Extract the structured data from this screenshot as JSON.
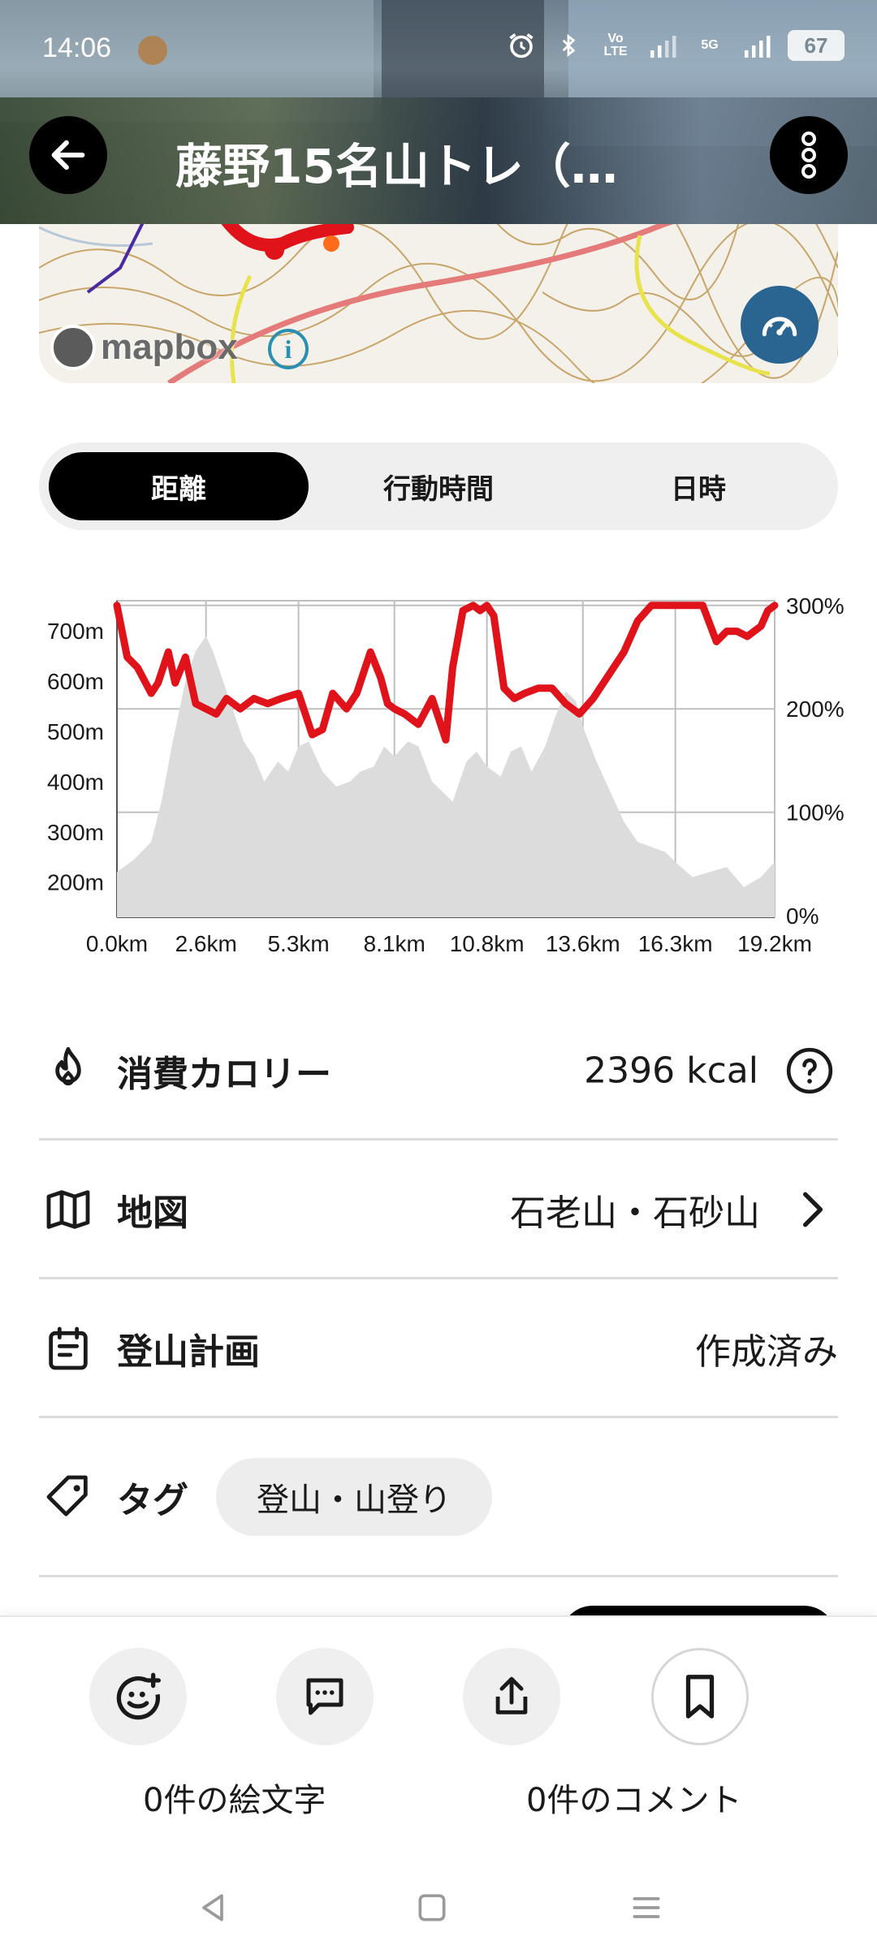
{
  "status_bar": {
    "time": "14:06",
    "network_label": "Vo LTE",
    "network_5g": "5G",
    "battery": "67"
  },
  "header": {
    "title": "藤野15名山トレ（…"
  },
  "map": {
    "attribution": "mapbox",
    "info_symbol": "i"
  },
  "segments": [
    {
      "label": "距離",
      "active": true
    },
    {
      "label": "行動時間",
      "active": false
    },
    {
      "label": "日時",
      "active": false
    }
  ],
  "chart_data": {
    "type": "area",
    "x_unit": "km",
    "x_tick_labels": [
      "0.0km",
      "2.6km",
      "5.3km",
      "8.1km",
      "10.8km",
      "13.6km",
      "16.3km",
      "19.2km"
    ],
    "x_range": [
      0.0,
      19.2
    ],
    "y_left_tick_labels": [
      "700m",
      "600m",
      "500m",
      "400m",
      "300m",
      "200m"
    ],
    "y_left_range": [
      130,
      760
    ],
    "y_right_tick_labels": [
      "300%",
      "200%",
      "100%",
      "0%"
    ],
    "y_right_range": [
      0,
      300
    ],
    "grid": true,
    "series": [
      {
        "kind": "elevation",
        "color": "#d9d9d9",
        "x": [
          0.0,
          0.5,
          1.0,
          1.3,
          1.6,
          2.0,
          2.3,
          2.6,
          2.8,
          3.1,
          3.4,
          3.7,
          4.0,
          4.3,
          4.7,
          5.0,
          5.3,
          5.6,
          6.0,
          6.4,
          6.8,
          7.1,
          7.5,
          7.8,
          8.1,
          8.5,
          8.8,
          9.2,
          9.5,
          9.8,
          10.2,
          10.5,
          10.8,
          11.2,
          11.5,
          11.8,
          12.1,
          12.5,
          12.8,
          13.1,
          13.4,
          13.6,
          14.0,
          14.4,
          14.8,
          15.2,
          15.6,
          16.0,
          16.3,
          16.8,
          17.3,
          17.8,
          18.3,
          18.8,
          19.2
        ],
        "y": [
          220,
          245,
          280,
          360,
          470,
          600,
          660,
          690,
          660,
          600,
          540,
          480,
          450,
          400,
          440,
          420,
          470,
          480,
          420,
          390,
          400,
          420,
          430,
          470,
          450,
          480,
          470,
          400,
          380,
          360,
          440,
          460,
          430,
          410,
          460,
          470,
          420,
          470,
          530,
          580,
          560,
          510,
          440,
          380,
          320,
          280,
          270,
          260,
          240,
          210,
          220,
          230,
          190,
          210,
          240
        ]
      },
      {
        "kind": "speed_percent",
        "color": "#e0121a",
        "x": [
          0.0,
          0.3,
          0.6,
          1.0,
          1.2,
          1.5,
          1.7,
          2.0,
          2.3,
          2.6,
          2.9,
          3.2,
          3.6,
          4.0,
          4.4,
          4.8,
          5.3,
          5.7,
          6.0,
          6.3,
          6.7,
          7.0,
          7.4,
          7.7,
          7.9,
          8.1,
          8.4,
          8.8,
          9.2,
          9.6,
          9.8,
          10.1,
          10.4,
          10.6,
          10.8,
          11.0,
          11.3,
          11.6,
          11.9,
          12.3,
          12.7,
          13.1,
          13.5,
          13.9,
          14.3,
          14.8,
          15.2,
          15.6,
          15.9,
          16.2,
          16.6,
          17.1,
          17.5,
          17.8,
          18.1,
          18.4,
          18.8,
          19.0,
          19.2
        ],
        "y": [
          300,
          250,
          240,
          215,
          225,
          255,
          225,
          250,
          205,
          200,
          195,
          210,
          200,
          210,
          205,
          210,
          215,
          175,
          180,
          215,
          200,
          215,
          255,
          230,
          205,
          200,
          195,
          185,
          210,
          170,
          240,
          295,
          300,
          295,
          300,
          290,
          220,
          210,
          215,
          220,
          220,
          205,
          195,
          210,
          230,
          255,
          285,
          300,
          300,
          300,
          300,
          300,
          265,
          275,
          275,
          270,
          280,
          295,
          300
        ]
      }
    ]
  },
  "rows": {
    "calories": {
      "label": "消費カロリー",
      "value": "2396 kcal"
    },
    "map": {
      "label": "地図",
      "value": "石老山・石砂山"
    },
    "plan": {
      "label": "登山計画",
      "value": "作成済み"
    },
    "tags": {
      "label": "タグ",
      "chip": "登山・山登り"
    }
  },
  "actions": {
    "emoji_label": "0件の絵文字",
    "comment_label": "0件のコメント"
  },
  "colors": {
    "accent": "#000000",
    "route_red": "#e0121a",
    "speed_button": "#2a6592",
    "info_blue": "#2a8fb0"
  }
}
